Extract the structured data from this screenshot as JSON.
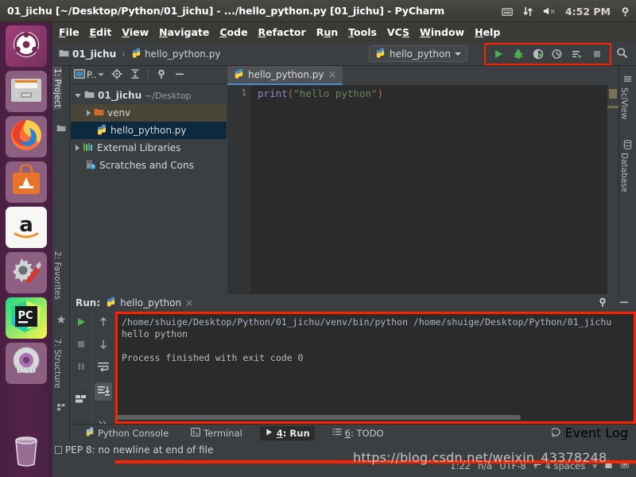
{
  "desktop": {
    "window_title": "01_jichu [~/Desktop/Python/01_jichu] - .../hello_python.py [01_jichu] - PyCharm",
    "tray": {
      "keyboard_icon": "keyboard-icon",
      "network_icon": "network-updown-icon",
      "volume_icon": "volume-muted-icon",
      "clock": "4:52 PM",
      "gear_icon": "system-gear-icon"
    },
    "dock": {
      "items": [
        {
          "name": "ubuntu-dash",
          "icon": "ubuntu-logo-icon",
          "active": false
        },
        {
          "name": "files",
          "icon": "file-manager-icon",
          "active": false
        },
        {
          "name": "firefox",
          "icon": "firefox-icon",
          "active": false
        },
        {
          "name": "ubuntu-software",
          "icon": "software-center-icon",
          "active": false
        },
        {
          "name": "amazon",
          "icon": "amazon-icon",
          "active": false
        },
        {
          "name": "system-settings",
          "icon": "settings-tools-icon",
          "active": false
        },
        {
          "name": "pycharm",
          "icon": "pycharm-icon",
          "active": true
        },
        {
          "name": "dvd-drive",
          "icon": "dvd-disc-icon",
          "active": false
        },
        {
          "name": "trash",
          "icon": "trash-bin-icon",
          "active": false
        }
      ]
    }
  },
  "menubar": {
    "items": [
      {
        "label": "File",
        "mnemonic": "F"
      },
      {
        "label": "Edit",
        "mnemonic": "E"
      },
      {
        "label": "View",
        "mnemonic": "V"
      },
      {
        "label": "Navigate",
        "mnemonic": "N"
      },
      {
        "label": "Code",
        "mnemonic": "C"
      },
      {
        "label": "Refactor",
        "mnemonic": "R"
      },
      {
        "label": "Run",
        "mnemonic": "u"
      },
      {
        "label": "Tools",
        "mnemonic": "T"
      },
      {
        "label": "VCS",
        "mnemonic": "S"
      },
      {
        "label": "Window",
        "mnemonic": "W"
      },
      {
        "label": "Help",
        "mnemonic": "H"
      }
    ]
  },
  "navbar": {
    "breadcrumb": [
      {
        "label": "01_jichu",
        "icon": "folder-icon",
        "bold": true
      },
      {
        "label": "hello_python.py",
        "icon": "python-file-icon",
        "bold": false
      }
    ],
    "separator": "›",
    "run_config": {
      "label": "hello_python",
      "icon": "python-icon",
      "caret": "chevron-down-icon"
    },
    "toolbar_buttons": [
      {
        "name": "run-button",
        "icon": "run-play-icon"
      },
      {
        "name": "debug-button",
        "icon": "debug-bug-icon"
      },
      {
        "name": "run-with-coverage-button",
        "icon": "coverage-icon"
      },
      {
        "name": "profile-button",
        "icon": "profile-clock-icon"
      },
      {
        "name": "run-with-console-button",
        "icon": "run-list-icon"
      },
      {
        "name": "stop-button",
        "icon": "stop-square-icon"
      }
    ],
    "search_icon": "search-icon",
    "highlight_color": "#ff2200"
  },
  "left_tool_strip": {
    "tabs": [
      {
        "label": "1: Project",
        "icon": "folder-icon",
        "selected": true
      },
      {
        "label": "2: Favorites",
        "icon": "star-icon",
        "selected": false
      },
      {
        "label": "7: Structure",
        "icon": "structure-icon",
        "selected": false
      }
    ]
  },
  "right_tool_strip": {
    "tabs": [
      {
        "label": "SciView",
        "icon": "grid-icon"
      },
      {
        "label": "Database",
        "icon": "database-icon"
      }
    ]
  },
  "project_panel": {
    "toolbar": [
      {
        "name": "project-view-selector",
        "label": "P..",
        "icon": "project-window-icon",
        "caret": "chevron-down-icon"
      },
      {
        "name": "select-opened-file-button",
        "icon": "locate-target-icon"
      },
      {
        "name": "collapse-all-button",
        "icon": "collapse-all-icon"
      },
      {
        "name": "settings-button",
        "icon": "gear-icon"
      },
      {
        "name": "hide-button",
        "icon": "minimize-icon"
      }
    ],
    "tree": [
      {
        "label": "01_jichu",
        "path_hint": "~/Desktop",
        "icon": "folder-icon",
        "arrow": "down",
        "indent": 0,
        "bold": true,
        "state": "normal"
      },
      {
        "label": "venv",
        "path_hint": "",
        "icon": "folder-orange-icon",
        "arrow": "right",
        "indent": 1,
        "bold": false,
        "state": "excluded"
      },
      {
        "label": "hello_python.py",
        "path_hint": "",
        "icon": "python-file-icon",
        "arrow": "none",
        "indent": 2,
        "bold": false,
        "state": "selected"
      },
      {
        "label": "External Libraries",
        "path_hint": "",
        "icon": "libraries-icon",
        "arrow": "right",
        "indent": 0,
        "bold": false,
        "state": "normal"
      },
      {
        "label": "Scratches and Cons",
        "path_hint": "",
        "icon": "scratches-icon",
        "arrow": "none",
        "indent": 1,
        "bold": false,
        "state": "normal"
      }
    ]
  },
  "editor": {
    "tab": {
      "label": "hello_python.py",
      "icon": "python-file-icon",
      "close": "×"
    },
    "lines": [
      {
        "number": "1",
        "tokens": [
          {
            "text": "print",
            "type": "function"
          },
          {
            "text": "(",
            "type": "paren"
          },
          {
            "text": "\"hello python\"",
            "type": "string"
          },
          {
            "text": ")",
            "type": "paren"
          }
        ]
      }
    ]
  },
  "run_window": {
    "label": "Run:",
    "tab": {
      "label": "hello_python",
      "icon": "python-icon",
      "close": "×"
    },
    "header_buttons": [
      {
        "name": "run-settings-button",
        "icon": "gear-icon"
      },
      {
        "name": "hide-run-window-button",
        "icon": "minimize-icon"
      }
    ],
    "side_toolbar": [
      {
        "name": "rerun-button",
        "icon": "run-play-icon"
      },
      {
        "name": "stop-process-button",
        "icon": "stop-square-icon"
      },
      {
        "name": "pause-output-button",
        "icon": "pause-icon"
      },
      {
        "name": "print-button",
        "icon": "layout-icon"
      },
      {
        "name": "expand-button",
        "icon": "chevrons-icon"
      }
    ],
    "side_toolbar2": [
      {
        "name": "up-the-stack-button",
        "icon": "arrow-up-icon"
      },
      {
        "name": "down-the-stack-button",
        "icon": "arrow-down-icon"
      },
      {
        "name": "soft-wrap-button",
        "icon": "wrap-icon"
      },
      {
        "name": "scroll-to-end-button",
        "icon": "scroll-end-icon"
      },
      {
        "name": "more-button",
        "icon": "chevrons-icon"
      }
    ],
    "console_border_color": "#ff2200",
    "console_lines": [
      "/home/shuige/Desktop/Python/01_jichu/venv/bin/python /home/shuige/Desktop/Python/01_jichu",
      "hello python",
      "",
      "Process finished with exit code 0"
    ]
  },
  "bottom_tabs": {
    "items": [
      {
        "label": "Python Console",
        "icon": "python-console-icon",
        "selected": false,
        "mnemonic": ""
      },
      {
        "label": "Terminal",
        "icon": "terminal-icon",
        "selected": false,
        "mnemonic": ""
      },
      {
        "label": "4: Run",
        "icon": "run-play-icon",
        "selected": true,
        "mnemonic": "4"
      },
      {
        "label": "6: TODO",
        "icon": "todo-list-icon",
        "selected": false,
        "mnemonic": "6"
      }
    ],
    "event_log": {
      "label": "Event Log",
      "icon": "event-log-icon"
    }
  },
  "status_bar": {
    "message": "PEP 8: no newline at end of file",
    "inspection_icon": "inspection-box-icon",
    "caret_position": "1:22",
    "line_separator": "n/a",
    "encoding": "UTF-8",
    "indent": "4 spaces",
    "lock_icon": "lock-icon",
    "memory_icon": "memory-icon",
    "separator": "▾"
  },
  "watermark": "https://blog.csdn.net/weixin_43378248"
}
